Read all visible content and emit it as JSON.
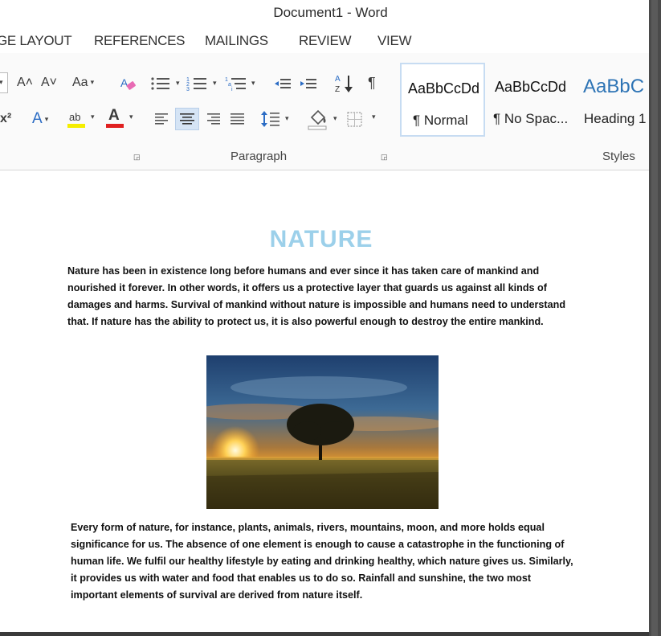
{
  "window": {
    "title": "Document1 - Word"
  },
  "tabs": [
    "GE LAYOUT",
    "REFERENCES",
    "MAILINGS",
    "REVIEW",
    "VIEW"
  ],
  "ribbon": {
    "font_row1": {
      "grow_font": "A˄",
      "shrink_font": "A˅",
      "change_case": "Aa"
    },
    "font_row2": {
      "superscript": "x²",
      "text_effects": "A",
      "highlight": "ab",
      "font_color": "A"
    },
    "paragraph": {
      "sort_icon": "sort-az-icon",
      "pilcrow": "¶",
      "label": "Paragraph"
    },
    "styles": {
      "label": "Styles",
      "items": [
        {
          "sample": "AaBbCcDd",
          "name": "¶ Normal"
        },
        {
          "sample": "AaBbCcDd",
          "name": "¶ No Spac..."
        },
        {
          "sample": "AaBbC",
          "name": "Heading 1"
        }
      ]
    }
  },
  "document": {
    "title": "NATURE",
    "paragraph1": "Nature has been in existence long before humans and ever since it has taken care of mankind and nourished it forever. In other words, it offers us a protective layer that guards us against all kinds of damages and harms. Survival of mankind without nature is impossible and humans need to understand that. If nature has the ability to protect us, it is also powerful enough to destroy the entire mankind.",
    "image_alt": "sunset landscape with a lone tree",
    "paragraph2": "Every form of nature, for instance, plants, animals, rivers, mountains, moon, and more holds equal significance for us. The absence of one element is enough to cause a catastrophe in the functioning of human life. We fulfil our healthy lifestyle by eating and drinking healthy, which nature gives us. Similarly, it provides us with water and food that enables us to do so. Rainfall and sunshine, the two most important elements of survival are derived from nature itself."
  },
  "colors": {
    "title_color": "#9cd0ea",
    "heading_style_color": "#2e74b5",
    "font_color_bar": "#e02020",
    "highlight_bar": "#f5ee00",
    "selected_align_bg": "#d5e4f5"
  }
}
